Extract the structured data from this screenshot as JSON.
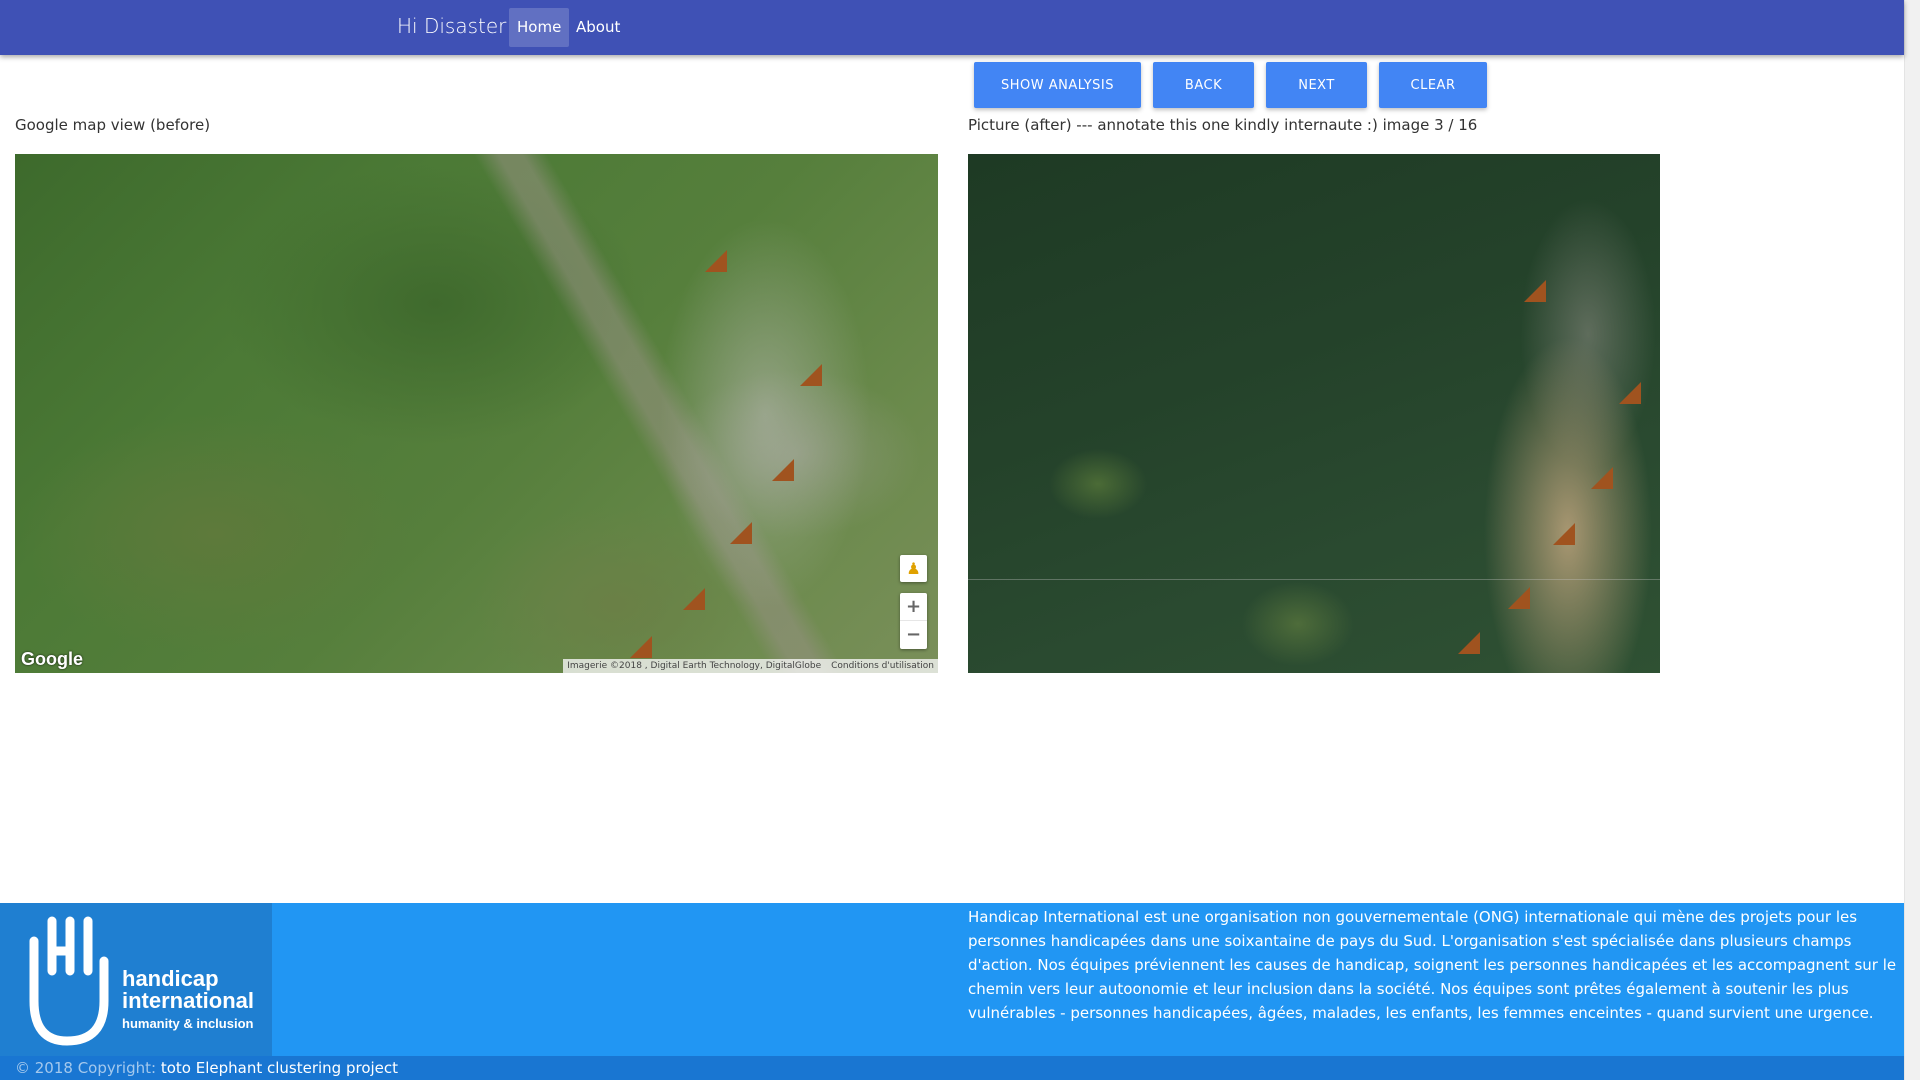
{
  "navbar": {
    "brand": "Hi Disaster",
    "links": [
      {
        "label": "Home",
        "active": true
      },
      {
        "label": "About",
        "active": false
      }
    ],
    "color": "#3f51b5"
  },
  "toolbar": {
    "show_analysis_label": "SHOW ANALYSIS",
    "back_label": "BACK",
    "next_label": "NEXT",
    "clear_label": "CLEAR",
    "button_color": "#4285f4"
  },
  "before_panel": {
    "caption": "Google map view (before)",
    "google_logo": "Google",
    "attribution": "Imagerie ©2018 , Digital Earth Technology, DigitalGlobe",
    "terms": "Conditions d'utilisation",
    "zoom_in": "+",
    "zoom_out": "−"
  },
  "after_panel": {
    "caption": "Picture (after) --- annotate this one kindly internaute :) image 3 / 16"
  },
  "footer": {
    "logo_line1": "handicap",
    "logo_line2": "international",
    "logo_line3": "humanity & inclusion",
    "description": "Handicap International est une organisation non gouvernementale (ONG) internationale qui mène des projets pour les personnes handicapées dans une soixantaine de pays du Sud. L'organisation s'est spécialisée dans plusieurs champs d'action. Nos équipes préviennent les causes de handicap, soignent les personnes handicapées et les accompagnent sur le chemin vers leur autoonomie et leur inclusion dans la société. Nos équipes sont prêtes également à soutenir les plus vulnérables - personnes handicapées, âgées, malades, les enfants, les femmes enceintes - quand survient une urgence.",
    "copyright_prefix": "© 2018 Copyright:",
    "copyright_link": "toto Elephant clustering project",
    "color": "#2196f3"
  }
}
